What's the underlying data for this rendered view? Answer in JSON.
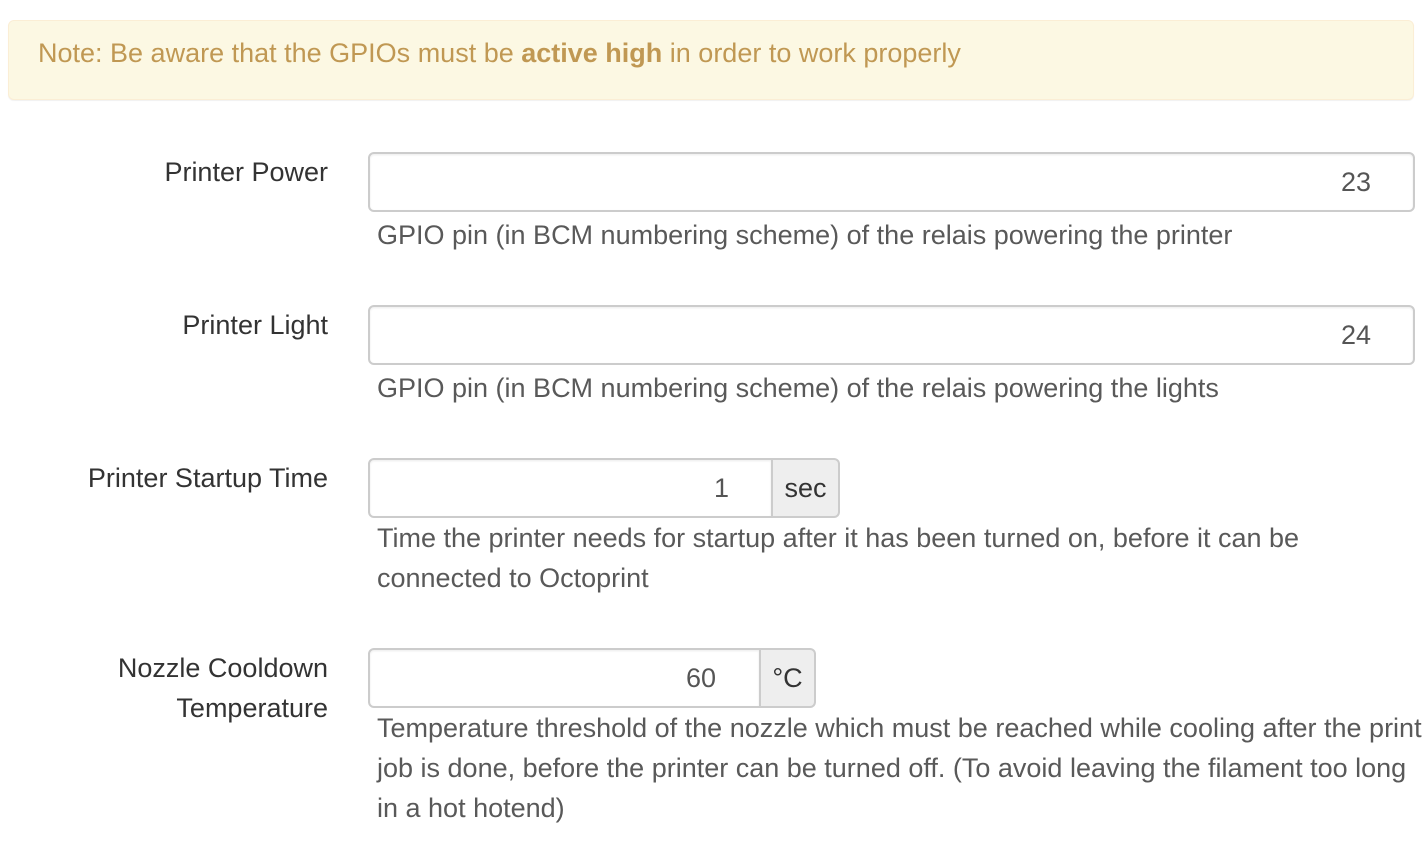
{
  "note": {
    "prefix": "Note: Be aware that the GPIOs must be ",
    "emphasis": "active high",
    "suffix": " in order to work properly"
  },
  "fields": {
    "printer_power": {
      "label": "Printer Power",
      "value": "23",
      "help": "GPIO pin (in BCM numbering scheme) of the relais powering the printer"
    },
    "printer_light": {
      "label": "Printer Light",
      "value": "24",
      "help": "GPIO pin (in BCM numbering scheme) of the relais powering the lights"
    },
    "startup_time": {
      "label": "Printer Startup Time",
      "value": "1",
      "unit": "sec",
      "help": "Time the printer needs for startup after it has been turned on, before it can be connected to Octoprint"
    },
    "cooldown_temp": {
      "label_line1": "Nozzle Cooldown",
      "label_line2": "Temperature",
      "value": "60",
      "unit": "°C",
      "help": "Temperature threshold of the nozzle which must be reached while cooling after the print job is done, before the printer can be turned off. (To avoid leaving the filament too long in a hot hotend)"
    }
  }
}
